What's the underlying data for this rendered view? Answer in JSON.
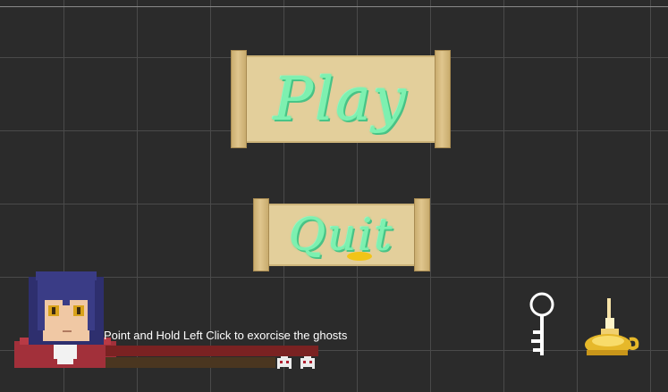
{
  "menu": {
    "play_label": "Play",
    "quit_label": "Quit"
  },
  "hud": {
    "hint_text": "Point and Hold Left Click to exorcise the ghosts",
    "exorcise_progress": 1.0,
    "secondary_progress": 1.0,
    "ghost_count": 2
  },
  "inventory": {
    "items": [
      "key-icon",
      "oil-lamp-icon"
    ]
  },
  "colors": {
    "background": "#2b2b2b",
    "grid": "#4a4a4a",
    "parchment": "#e3cf9b",
    "ghost_text": "#7ef0b0",
    "bar_red": "#7a2222",
    "lamp_gold": "#f2c418"
  }
}
